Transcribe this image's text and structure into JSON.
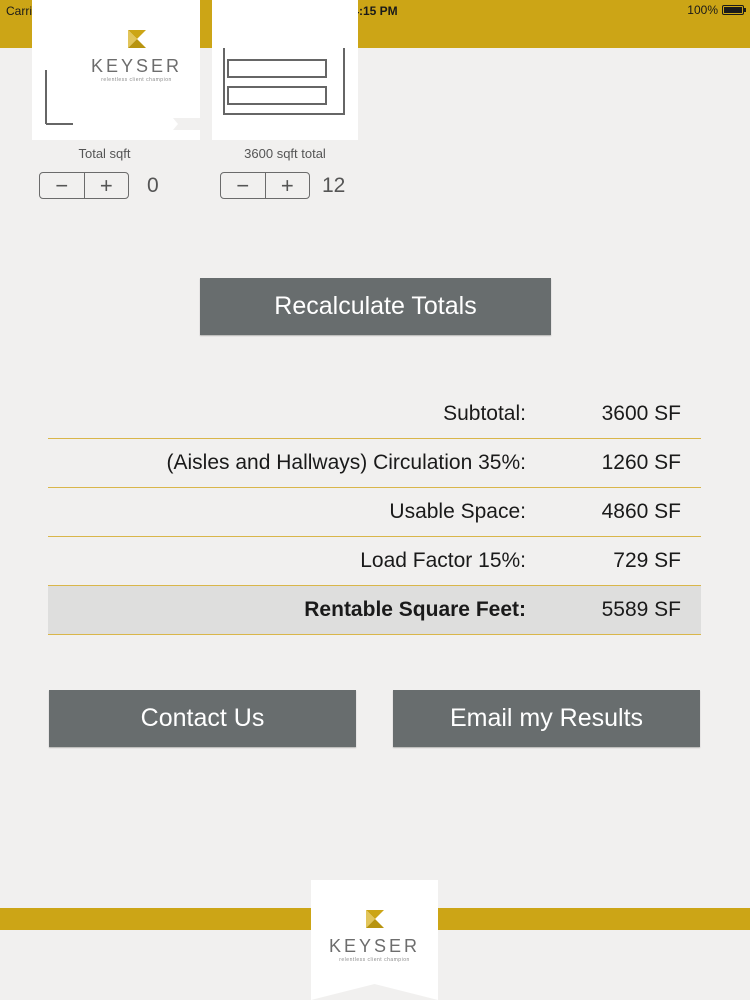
{
  "status_bar": {
    "carrier": "Carrier",
    "time": "4:15 PM",
    "battery": "100%"
  },
  "brand": {
    "name": "KEYSER",
    "tagline": "relentless client champion",
    "accent_color": "#cca516"
  },
  "items": [
    {
      "label": "Total sqft",
      "count": "0"
    },
    {
      "label": "3600 sqft total",
      "count": "12"
    }
  ],
  "stepper": {
    "minus": "−",
    "plus": "+"
  },
  "recalculate_button": "Recalculate Totals",
  "summary": [
    {
      "label": "Subtotal:",
      "value": "3600 SF"
    },
    {
      "label": "(Aisles and Hallways) Circulation 35%:",
      "value": "1260 SF"
    },
    {
      "label": "Usable Space:",
      "value": "4860 SF"
    },
    {
      "label": "Load Factor 15%:",
      "value": "729 SF"
    },
    {
      "label": "Rentable Square Feet:",
      "value": "5589 SF"
    }
  ],
  "contact_button": "Contact Us",
  "email_button": "Email my Results"
}
